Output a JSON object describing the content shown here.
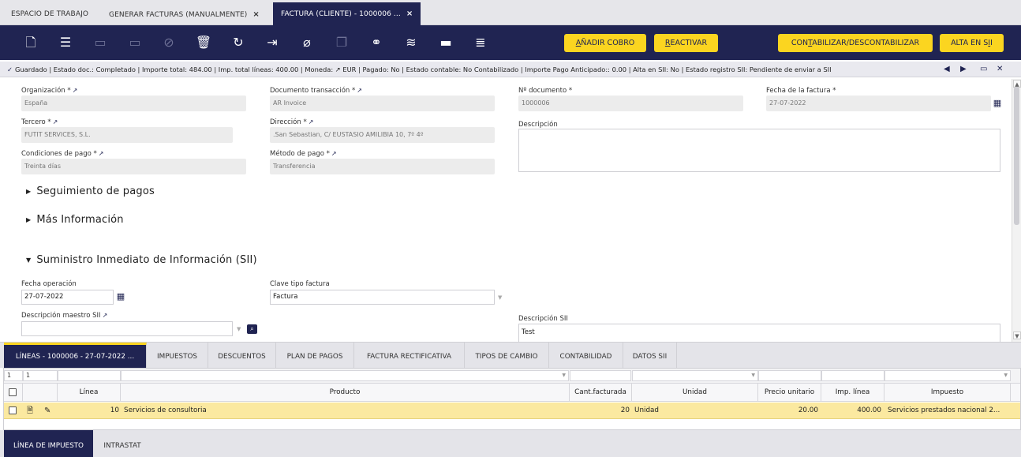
{
  "window_tabs": [
    {
      "label": "ESPACIO DE TRABAJO"
    },
    {
      "label": "GENERAR FACTURAS (MANUALMENTE)",
      "close": "×"
    },
    {
      "label": "FACTURA (CLIENTE) - 1000006 ...",
      "close": "×"
    }
  ],
  "toolbar": {
    "icons": [
      "new-document-icon",
      "new-row-icon",
      "save-icon",
      "save-close-icon",
      "cancel-icon",
      "delete-icon",
      "refresh-icon",
      "export-icon",
      "attachment-icon",
      "copy-icon",
      "link-icon",
      "audit-icon",
      "toggle-view-icon",
      "process-icon"
    ],
    "btn_cobro": "AÑADIR COBRO",
    "btn_reactivar": "REACTIVAR",
    "btn_contabilizar": "CONTABILIZAR/DESCONTABILIZAR",
    "btn_sii": "ALTA EN SII"
  },
  "status": {
    "text": "Guardado  |  Estado doc.: Completado  |  Importe total: 484.00  |  Imp. total líneas: 400.00  |  Moneda: ↗ EUR  |  Pagado: No  |  Estado contable: No Contabilizado  |  Importe Pago Anticipado:: 0.00  |  Alta en SII: No  |  Estado registro SII: Pendiente de enviar a SII"
  },
  "form": {
    "organizacion_label": "Organización *",
    "organizacion_value": "España",
    "doc_transaccion_label": "Documento transacción *",
    "doc_transaccion_value": "AR Invoice",
    "n_documento_label": "Nº documento *",
    "n_documento_value": "1000006",
    "fecha_factura_label": "Fecha de la factura *",
    "fecha_factura_value": "27-07-2022",
    "tercero_label": "Tercero *",
    "tercero_value": "FUTIT SERVICES, S.L.",
    "direccion_label": "Dirección *",
    "direccion_value": ".San Sebastian, C/ EUSTASIO AMILIBIA 10, 7º 4º",
    "descripcion_label": "Descripción",
    "condiciones_label": "Condiciones de pago *",
    "condiciones_value": "Treinta días",
    "metodo_label": "Método de pago *",
    "metodo_value": "Transferencia",
    "sec_seguimiento": "Seguimiento de pagos",
    "sec_mas": "Más Información",
    "sec_sii": "Suministro Inmediato de Información (SII)",
    "fecha_op_label": "Fecha operación",
    "fecha_op_value": "27-07-2022",
    "clave_label": "Clave tipo factura",
    "clave_value": "Factura",
    "desc_maestro_label": "Descripción maestro SII",
    "desc_maestro_value": "",
    "desc_sii_label": "Descripción SII",
    "desc_sii_value": "Test"
  },
  "subtabs": [
    "LÍNEAS - 1000006 - 27-07-2022 ...",
    "IMPUESTOS",
    "DESCUENTOS",
    "PLAN DE PAGOS",
    "FACTURA RECTIFICATIVA",
    "TIPOS DE CAMBIO",
    "CONTABILIDAD",
    "DATOS SII"
  ],
  "grid": {
    "filter_a": "1",
    "filter_b": "1",
    "headers": [
      "Línea",
      "Producto",
      "Cant.facturada",
      "Unidad",
      "Precio unitario",
      "Imp. línea",
      "Impuesto"
    ],
    "rows": [
      {
        "linea": "10",
        "producto": "Servicios de consultoria",
        "cantidad": "20",
        "unidad": "Unidad",
        "precio": "20.00",
        "importe": "400.00",
        "impuesto": "Servicios prestados nacional 2..."
      }
    ]
  },
  "bottom_tabs": [
    "LÍNEA DE IMPUESTO",
    "INTRASTAT"
  ]
}
